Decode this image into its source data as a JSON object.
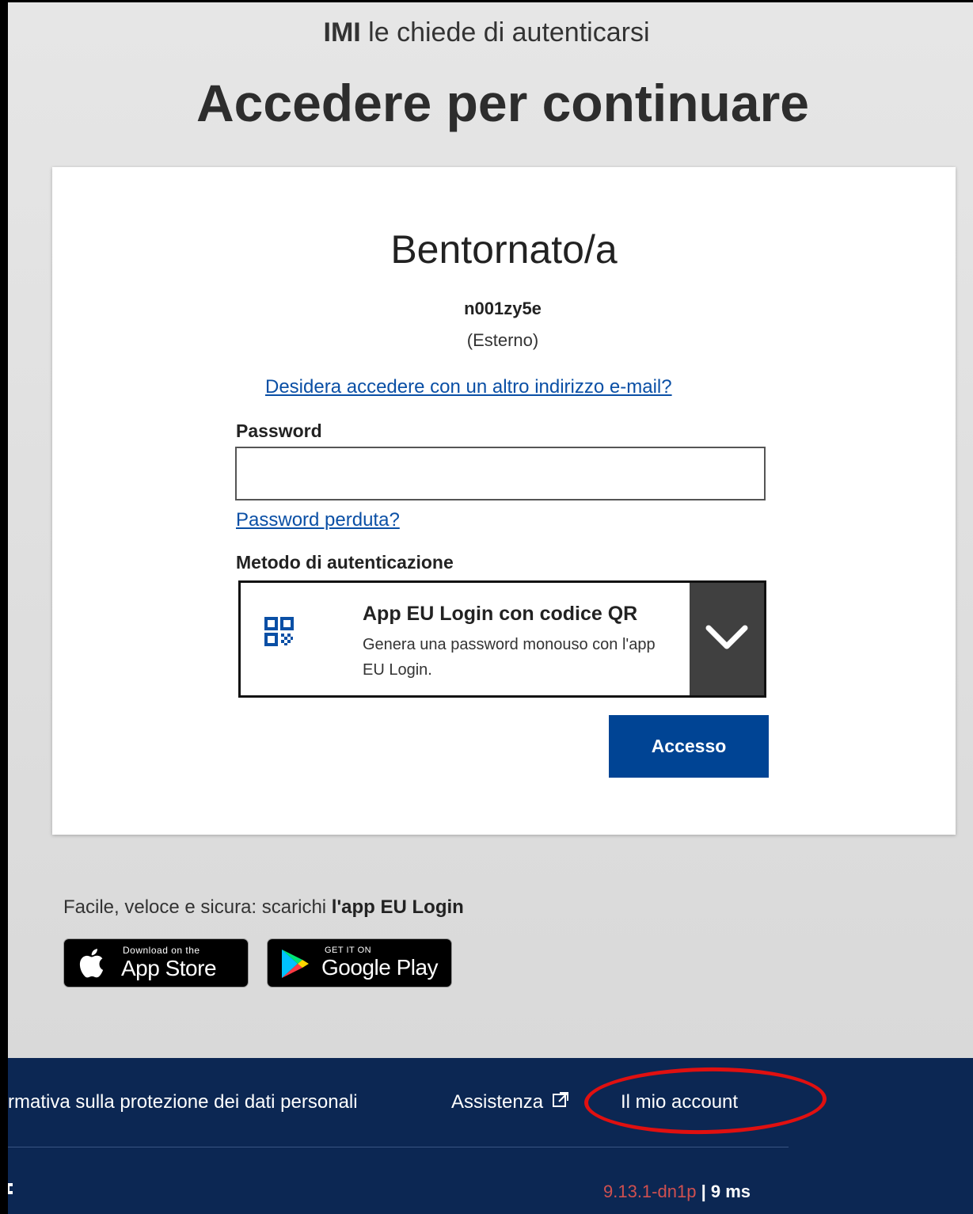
{
  "header": {
    "app_name": "IMI",
    "auth_request": "le chiede di autenticarsi",
    "title": "Accedere per continuare"
  },
  "login": {
    "welcome": "Bentornato/a",
    "username": "n001zy5e",
    "user_type": "(Esterno)",
    "alt_email_link": "Desidera accedere con un altro indirizzo e-mail?",
    "password_label": "Password",
    "password_value": "",
    "lost_password_link": "Password perduta?",
    "method_label": "Metodo di autenticazione",
    "method": {
      "title": "App EU Login con codice QR",
      "description": "Genera una password monouso con l'app EU Login.",
      "icon": "qr-code-icon"
    },
    "submit_label": "Accesso"
  },
  "promo": {
    "text": "Facile, veloce e sicura: scarichi ",
    "bold": "l'app EU Login",
    "app_store": {
      "small": "Download on the",
      "big": "App Store"
    },
    "google_play": {
      "small": "GET IT ON",
      "big": "Google Play"
    }
  },
  "footer": {
    "links": [
      "rmativa sulla protezione dei dati personali",
      "Assistenza",
      "Il mio account"
    ],
    "version": "9.13.1-dn1p",
    "separator": "|",
    "timing": "9 ms"
  },
  "colors": {
    "primary_button": "#004494",
    "footer_bg": "#0c2753",
    "link": "#0a4fa5",
    "annotation": "#e01010"
  }
}
